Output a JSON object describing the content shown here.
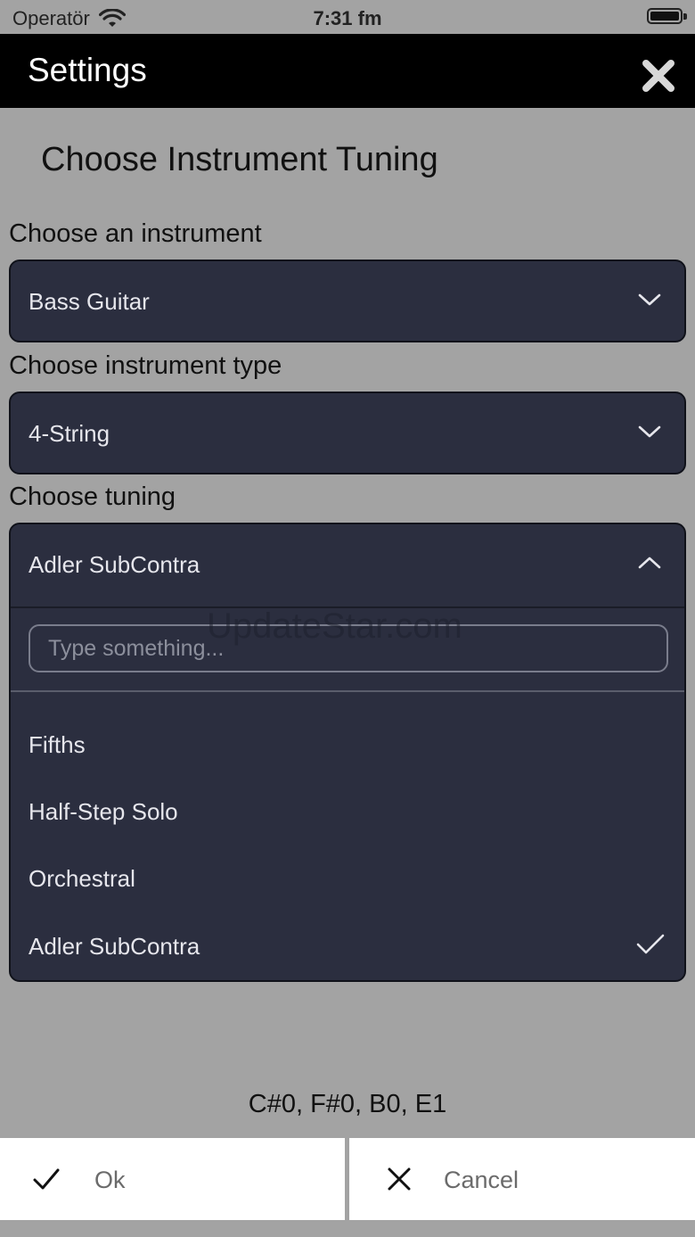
{
  "status_bar": {
    "carrier": "Operatör",
    "time": "7:31 fm"
  },
  "header": {
    "title": "Settings",
    "close_icon": "close-icon"
  },
  "main": {
    "heading": "Choose Instrument Tuning",
    "instrument": {
      "label": "Choose an instrument",
      "value": "Bass Guitar"
    },
    "instrument_type": {
      "label": "Choose instrument type",
      "value": "4-String"
    },
    "tuning": {
      "label": "Choose tuning",
      "value": "Adler SubContra",
      "search_placeholder": "Type something...",
      "options": [
        {
          "label": "Fifths",
          "selected": false
        },
        {
          "label": "Half-Step Solo",
          "selected": false
        },
        {
          "label": "Orchestral",
          "selected": false
        },
        {
          "label": "Adler SubContra",
          "selected": true
        }
      ]
    },
    "watermark": "UpdateStar.com",
    "notes": "C#0, F#0, B0, E1"
  },
  "actions": {
    "ok_label": "Ok",
    "cancel_label": "Cancel"
  },
  "colors": {
    "background": "#a3a3a3",
    "header": "#000000",
    "select_bg": "#2b2e3f"
  }
}
